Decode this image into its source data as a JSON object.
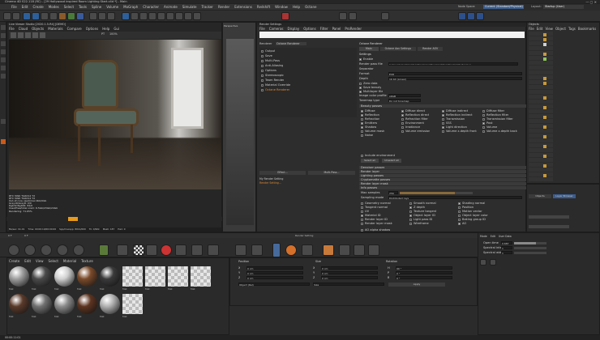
{
  "window": {
    "title": "Cinema 4D S22.118 (RC) - [29 Hollywood inspired Room Lighting Start.c4d *] - Main"
  },
  "menubar": [
    "File",
    "Edit",
    "Create",
    "Modes",
    "Select",
    "Tools",
    "Spline",
    "Volume",
    "MoGraph",
    "Character",
    "Animate",
    "Simulate",
    "Tracker",
    "Render",
    "Extensions",
    "Redshift",
    "Window",
    "Help",
    "Octane"
  ],
  "node_space": {
    "label": "Node Space:",
    "value": "Current (Standard/Physical)"
  },
  "layout": {
    "label": "Layout:",
    "value": "Startup (User)"
  },
  "viewport": {
    "title": "Live Viewer Studio [2020.1.5-R4] [DEMO]",
    "menu": [
      "File",
      "Cloud",
      "Objects",
      "Materials",
      "Compare",
      "Options",
      "Help",
      "Gui"
    ],
    "renderer_label": "PT",
    "zoom": "100%",
    "stats": [
      "RTX 3090 TGRX12 T2",
      "RTX 3090 TGRX12 T2",
      "Out-of-core used/max:0kb/0Gb",
      "Grey16/Grey8: 0/0",
      "Rgb32/Rgb64: 84/0",
      "Used/free/total vram: 6.5Gb/23Gb/24Gb",
      "Rendering: 71.65%",
      "Ms/sec: 91.01",
      "Time: 00:00:19/00:00:00",
      "Spp/maxspp: 8014/000",
      "Tri: 0/90k",
      "Mesh: 187",
      "Hair: 0"
    ]
  },
  "projection_tab": "Perspective",
  "render_settings": {
    "title": "Render Settings",
    "menu": [
      "File",
      "Cameras",
      "Display",
      "Options",
      "Filter",
      "Panel",
      "ProRender"
    ],
    "renderer_label": "Renderer",
    "renderer_value": "Octane Renderer",
    "tree": [
      "Output",
      "Save",
      "Multi-Pass",
      "Anti-Aliasing",
      "Options",
      "Stereoscopic",
      "Team Render",
      "Material Override",
      "Octane Renderer"
    ],
    "effect_button": "Effect...",
    "multipass_button": "Multi-Pass...",
    "my_render_setting": "My Render Setting",
    "render_setting_label": "Render Setting...",
    "octane_header": "Octane Renderer",
    "tabs": [
      "Main",
      "Octane Aov Settings",
      "Render AOV"
    ],
    "settings_label": "Settings",
    "enable_label": "Enable",
    "render_pass_file_label": "Render pass file",
    "render_pass_file_value": "C:\\Users\\User\\Desktop\\Rendering\\RoomLighting\\Render\\HL-Room-1",
    "separator": "Separator",
    "format_label": "Format",
    "format_value": "EXR",
    "depth_label": "Depth",
    "depth_value": "16 bit (Linear)",
    "passes": [
      "Zero data",
      "Save beauty",
      "Multilayer file",
      "Image color profile"
    ],
    "passes_value": "sRGB",
    "tonemap_label": "Tonemap type",
    "tonemap_value": "Do not tonemap",
    "beauty_passes": "Beauty passes",
    "pass_columns": [
      [
        "Diffuse",
        "Reflection",
        "Refraction",
        "Emitters",
        "Shadow",
        "Volume mask",
        "Noise"
      ],
      [
        "Diffuse direct",
        "Reflection direct",
        "Refraction filter",
        "Environment",
        "Irradiance",
        "Volume emission"
      ],
      [
        "Diffuse indirect",
        "Reflection indirect",
        "Transmission",
        "SSS",
        "Light direction",
        "Volume z-depth front"
      ],
      [
        "Diffuse filter",
        "Reflection filter",
        "Transmission filter",
        "Post",
        "Volume",
        "Volume z-depth back"
      ]
    ],
    "include_env": "Include environment",
    "select_all": "Select all",
    "unselect_all": "Unselect all",
    "sections": [
      "Denoiser passes",
      "Render layer",
      "Lighting passes",
      "Cryptomatte passes",
      "Render layer mask",
      "Info passes"
    ],
    "info_max_samples_label": "Max samples",
    "info_max_samples_value": "256",
    "sampling_mode_label": "Sampling mode",
    "sampling_mode_value": "Distributed rays",
    "info_columns": [
      [
        "Geometry normal",
        "Tangent normal",
        "UV",
        "Material ID",
        "Render layer ID",
        "Render layer mask"
      ],
      [
        "Smooth normal",
        "Z depth",
        "Texture tangent",
        "Object layer ID",
        "Light pass ID",
        "Wireframe"
      ],
      [
        "Shading normal",
        "Position",
        "Motion vector",
        "Object layer color",
        "Baking group ID",
        "AO"
      ]
    ],
    "info_extra": "Object ID",
    "ao_alpha": "AO alpha shadow"
  },
  "objects_panel": {
    "title": "Objects",
    "menu": [
      "File",
      "Edit",
      "View",
      "Object",
      "Tags",
      "Bookmarks"
    ],
    "objects_label": "Objects",
    "layer_browser": "Layer Browser"
  },
  "attributes": {
    "tabs": [
      "Mode",
      "Edit",
      "User Data"
    ],
    "buttons": [
      "Attributes",
      "Layers"
    ],
    "rows": [
      {
        "label": "Open time",
        "value": "0.687"
      },
      {
        "label": "Spectral intensity",
        "value": "1"
      },
      {
        "label": "Spectral width",
        "value": "1"
      }
    ]
  },
  "timeline": {
    "ticks": [
      "0",
      "5",
      "10",
      "15",
      "20",
      "25",
      "30",
      "35",
      "40",
      "45",
      "50",
      "55",
      "60",
      "65",
      "70",
      "75",
      "80",
      "85",
      "90"
    ],
    "start": "0 F",
    "end": "90 F",
    "current": "0 F"
  },
  "render_setting_bar": "Render Setting",
  "materials": {
    "menu": [
      "Create",
      "Edit",
      "View",
      "Select",
      "Material",
      "Texture"
    ],
    "items": [
      {
        "name": "Mat",
        "color": "#9e9e9e"
      },
      {
        "name": "Mat",
        "color": "#4a4a4a"
      },
      {
        "name": "Mat",
        "color": "#cfcfcf"
      },
      {
        "name": "Mat",
        "color": "#7a4a2a"
      },
      {
        "name": "Mat",
        "color": "#3a3a3a"
      },
      {
        "name": "Mat",
        "color": "checker"
      },
      {
        "name": "Mat",
        "color": "checker"
      },
      {
        "name": "Mat",
        "color": "checker"
      },
      {
        "name": "Mat",
        "color": "checker"
      },
      {
        "name": "Mat",
        "color": "#5a3a2a"
      },
      {
        "name": "Mat",
        "color": "#707070"
      },
      {
        "name": "Mat",
        "color": "#8a8a8a"
      },
      {
        "name": "Mat",
        "color": "#5c3420"
      },
      {
        "name": "Mat",
        "color": "#b0b0b0"
      },
      {
        "name": "Mat",
        "color": "checker"
      }
    ]
  },
  "coords": {
    "headers": [
      "Position",
      "Size",
      "Rotation"
    ],
    "rows": [
      [
        "X",
        "0 cm",
        "X",
        "0 cm",
        "H",
        "90 °"
      ],
      [
        "Y",
        "0 cm",
        "Y",
        "0 cm",
        "P",
        "0 °"
      ],
      [
        "Z",
        "0 cm",
        "Z",
        "0 cm",
        "B",
        "0 °"
      ]
    ],
    "mode_left": "Object (Rel)",
    "mode_mid": "Size",
    "apply": "Apply"
  },
  "status": "00:00:11:01"
}
